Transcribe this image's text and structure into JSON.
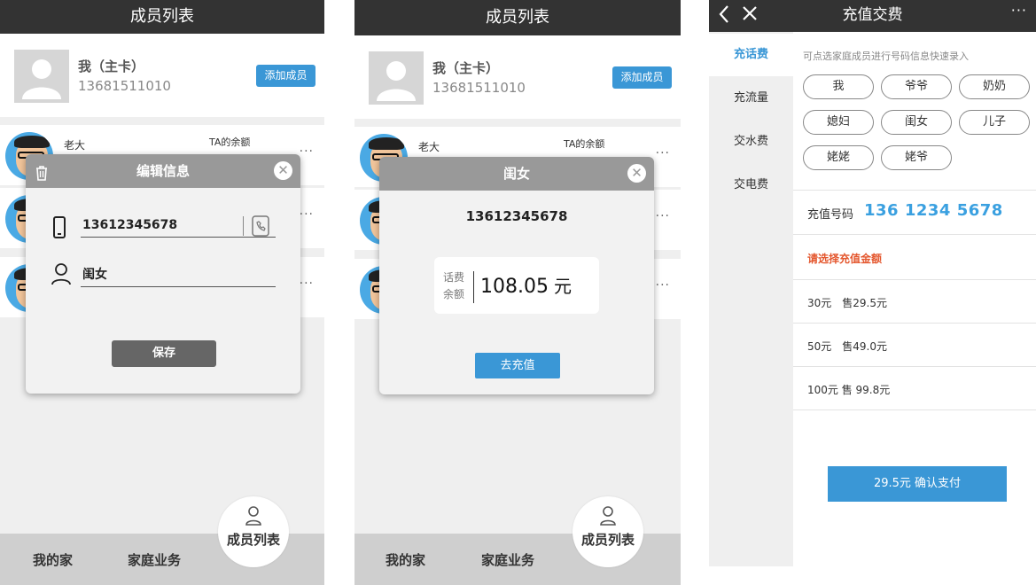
{
  "screen1": {
    "title": "成员列表",
    "me": {
      "name": "我（主卡）",
      "phone": "13681511010",
      "add_label": "添加成员"
    },
    "members": [
      {
        "name": "老大",
        "balance_label": "TA的余额"
      },
      {
        "name": "",
        "balance_label": ""
      },
      {
        "name": "",
        "balance_label": ""
      }
    ],
    "modal": {
      "title": "编辑信息",
      "phone_value": "13612345678",
      "name_value": "闺女",
      "save_label": "保存"
    },
    "nav": {
      "home": "我的家",
      "family": "家庭业务",
      "members": "成员列表"
    }
  },
  "screen2": {
    "title": "成员列表",
    "me": {
      "name": "我（主卡）",
      "phone": "13681511010",
      "add_label": "添加成员"
    },
    "members": [
      {
        "name": "老大",
        "balance_label": "TA的余额"
      }
    ],
    "modal": {
      "title": "闺女",
      "phone": "13612345678",
      "balance_label_1": "话费",
      "balance_label_2": "余额",
      "balance_value": "108.05",
      "balance_unit": "元",
      "recharge_label": "去充值"
    },
    "nav": {
      "home": "我的家",
      "family": "家庭业务",
      "members": "成员列表"
    }
  },
  "screen3": {
    "title": "充值交费",
    "sidebar": [
      {
        "label": "充话费",
        "active": true
      },
      {
        "label": "充流量",
        "active": false
      },
      {
        "label": "交水费",
        "active": false
      },
      {
        "label": "交电费",
        "active": false
      }
    ],
    "hint": "可点选家庭成员进行号码信息快速录入",
    "chips": [
      "我",
      "爷爷",
      "奶奶",
      "媳妇",
      "闺女",
      "儿子",
      "姥姥",
      "姥爷"
    ],
    "number_label": "充值号码",
    "number_value": "136 1234 5678",
    "choose_label": "请选择充值金额",
    "options": [
      "30元　售29.5元",
      "50元　售49.0元",
      "100元 售 99.8元"
    ],
    "pay_label": "29.5元 确认支付"
  },
  "colors": {
    "accent": "#3a97d6",
    "topbar": "#333333",
    "warning": "#e4572e"
  }
}
